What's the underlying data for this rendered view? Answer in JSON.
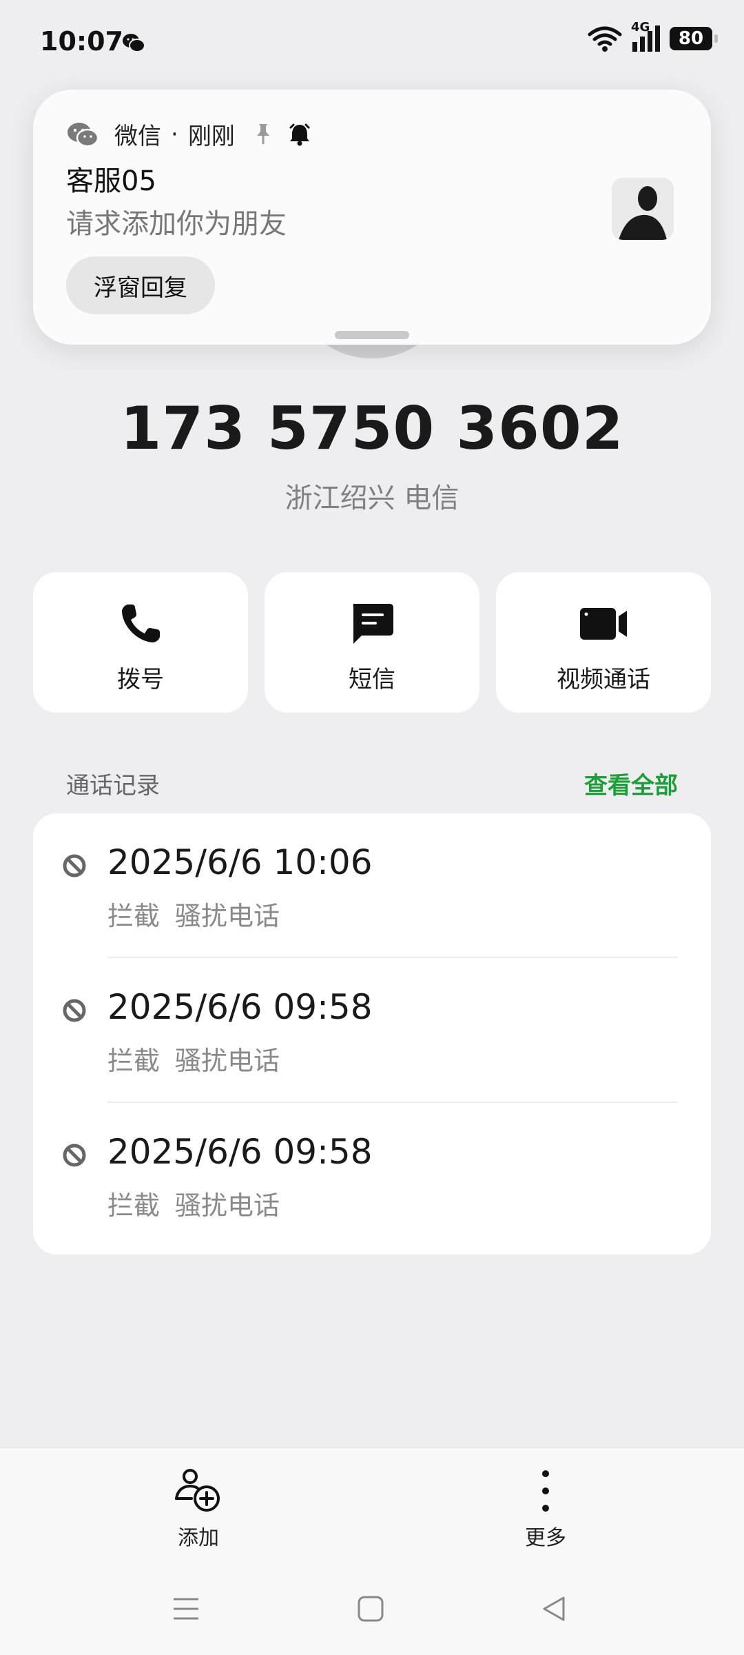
{
  "status_bar": {
    "time": "10:07",
    "network": "4G",
    "battery": "80"
  },
  "notification": {
    "app": "微信",
    "separator": "·",
    "time": "刚刚",
    "title": "客服05",
    "body": "请求添加你为朋友",
    "reply_label": "浮窗回复"
  },
  "contact": {
    "number": "173 5750 3602",
    "location": "浙江绍兴 电信"
  },
  "actions": [
    {
      "label": "拨号",
      "icon": "phone-icon"
    },
    {
      "label": "短信",
      "icon": "message-icon"
    },
    {
      "label": "视频通话",
      "icon": "video-icon"
    }
  ],
  "call_log": {
    "title": "通话记录",
    "view_all": "查看全部",
    "entries": [
      {
        "datetime": "2025/6/6 10:06",
        "status": "拦截",
        "type": "骚扰电话"
      },
      {
        "datetime": "2025/6/6 09:58",
        "status": "拦截",
        "type": "骚扰电话"
      },
      {
        "datetime": "2025/6/6 09:58",
        "status": "拦截",
        "type": "骚扰电话"
      }
    ]
  },
  "bottom_actions": {
    "add_label": "添加",
    "more_label": "更多"
  },
  "colors": {
    "accent_green": "#1e9e3a",
    "background": "#eeeef0"
  }
}
